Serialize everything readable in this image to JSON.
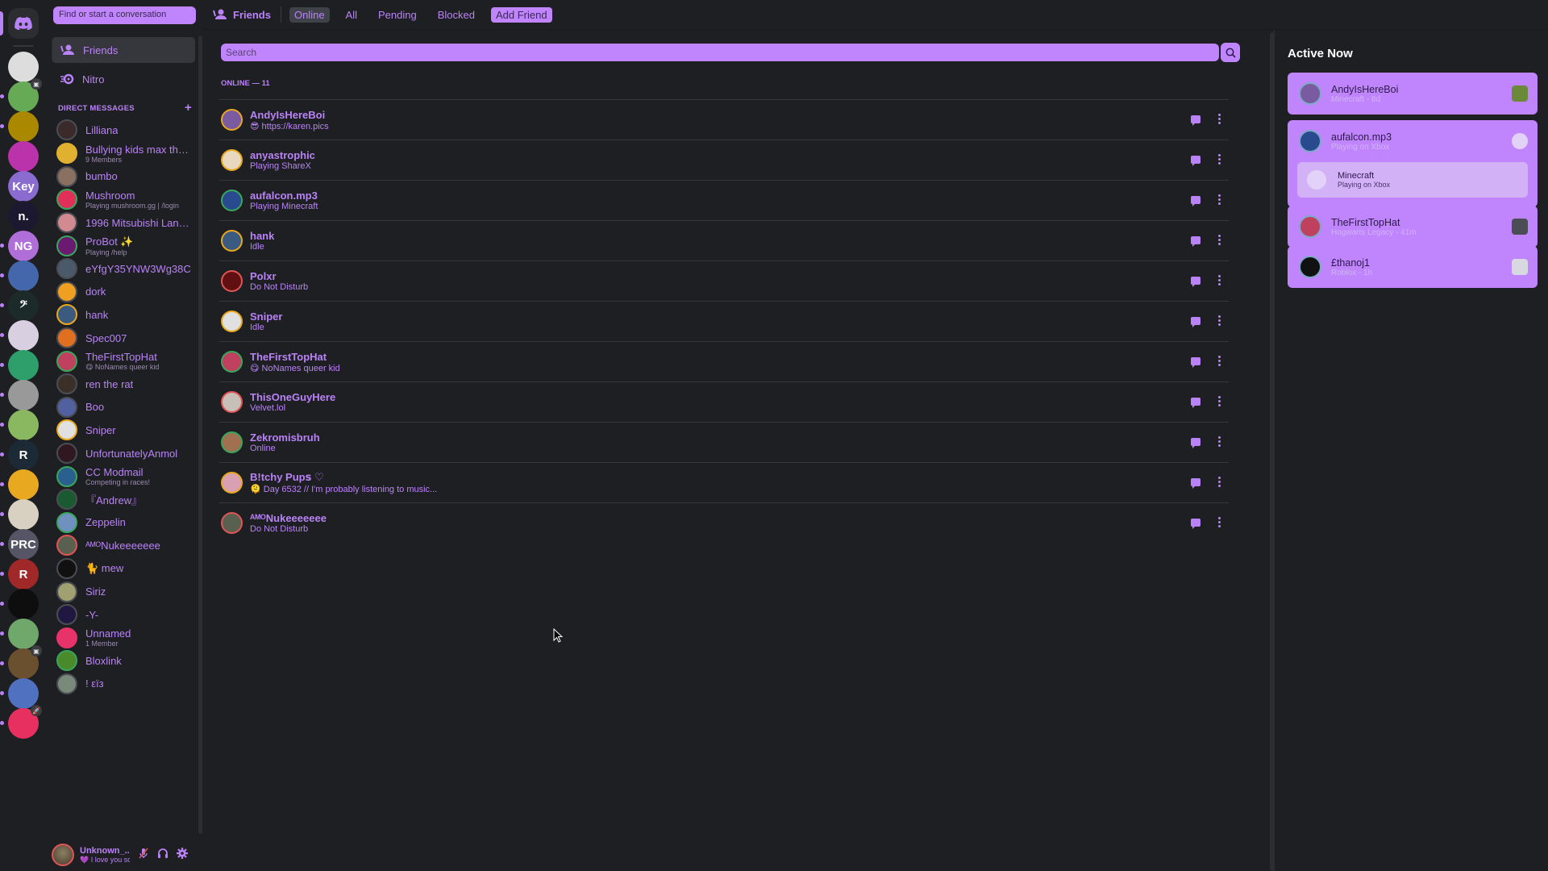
{
  "colors": {
    "accent": "#b983f7",
    "accent_fill": "#c085fc",
    "background": "#1e1f22",
    "idle": "#e8a820",
    "dnd": "#e05555",
    "online": "#3ba55c",
    "offline": "#4a4d54"
  },
  "servers": [
    {
      "name": "home",
      "icon": "discord-logo-icon"
    },
    {
      "name": "server-1",
      "color": "#ddd",
      "unread": false
    },
    {
      "name": "server-2",
      "color": "#6a5",
      "unread": true,
      "badge": "calendar-icon"
    },
    {
      "name": "server-3",
      "color": "#a80",
      "unread": true
    },
    {
      "name": "server-4",
      "color": "#b3a",
      "unread": false
    },
    {
      "name": "server-5",
      "label": "Key",
      "color": "#8a6bd0",
      "unread": false
    },
    {
      "name": "server-6",
      "label": "n.",
      "color": "#1c1830",
      "unread": false
    },
    {
      "name": "server-7",
      "label": "NG",
      "color": "#b06ed8",
      "unread": true
    },
    {
      "name": "server-8",
      "color": "#4466aa",
      "unread": true
    },
    {
      "name": "server-9",
      "label": "𝄢",
      "color": "#1c2a2a",
      "unread": true
    },
    {
      "name": "server-10",
      "color": "#d8d0e0",
      "unread": true
    },
    {
      "name": "server-11",
      "color": "#2e9e6a",
      "unread": true
    },
    {
      "name": "server-12",
      "color": "#999",
      "unread": true
    },
    {
      "name": "server-13",
      "color": "#8ab860",
      "unread": true
    },
    {
      "name": "server-14",
      "label": "R",
      "color": "#1c2a35",
      "unread": true
    },
    {
      "name": "server-15",
      "color": "#e8a820",
      "unread": true
    },
    {
      "name": "server-16",
      "color": "#d8d0c0",
      "unread": true
    },
    {
      "name": "server-17",
      "label": "PRC",
      "color": "#556",
      "unread": true
    },
    {
      "name": "server-18",
      "label": "R",
      "color": "#a02828",
      "unread": true
    },
    {
      "name": "server-19",
      "color": "#0e0e0e",
      "unread": true
    },
    {
      "name": "server-20",
      "color": "#6fa86a",
      "unread": true
    },
    {
      "name": "server-21",
      "color": "#6b5030",
      "unread": true,
      "badge": "calendar-icon"
    },
    {
      "name": "server-22",
      "color": "#5070c0",
      "unread": true
    },
    {
      "name": "server-23",
      "color": "#e83060",
      "unread": true,
      "badge": "rocket-icon"
    }
  ],
  "dm_sidebar": {
    "search_placeholder": "Find or start a conversation",
    "nav": [
      {
        "label": "Friends",
        "icon": "friends-icon"
      },
      {
        "label": "Nitro",
        "icon": "nitro-icon"
      }
    ],
    "header": "DIRECT MESSAGES",
    "add_label": "+",
    "items": [
      {
        "name": "Lilliana",
        "sub": "",
        "status": "offline",
        "color": "#3a2a2a"
      },
      {
        "name": "Bullying kids max the ...",
        "sub": "9 Members",
        "status": "group",
        "color": "#e0b030"
      },
      {
        "name": "bumbo",
        "sub": "",
        "status": "offline",
        "color": "#8a7060"
      },
      {
        "name": "Mushroom",
        "sub": "Playing mushroom.gg | /login",
        "status": "online",
        "color": "#e0305a"
      },
      {
        "name": "1996 Mitsubishi Lance...",
        "sub": "",
        "status": "offline",
        "color": "#d08a90"
      },
      {
        "name": "ProBot ✨",
        "sub": "Playing /help",
        "status": "online",
        "color": "#6a1a70"
      },
      {
        "name": "eYfgY35YNW3Wg38C",
        "sub": "",
        "status": "offline",
        "color": "#4a5a6a"
      },
      {
        "name": "dork",
        "sub": "",
        "status": "offline",
        "color": "#f0a020"
      },
      {
        "name": "hank",
        "sub": "",
        "status": "idle",
        "color": "#3a5a80"
      },
      {
        "name": "Spec007",
        "sub": "",
        "status": "offline",
        "color": "#e07020"
      },
      {
        "name": "TheFirstTopHat",
        "sub": "😋 NoNames queer kid",
        "status": "online",
        "color": "#c04060"
      },
      {
        "name": "ren the rat",
        "sub": "",
        "status": "offline",
        "color": "#3a3028"
      },
      {
        "name": "Boo",
        "sub": "",
        "status": "offline",
        "color": "#5060a0"
      },
      {
        "name": "Sniper",
        "sub": "",
        "status": "idle",
        "color": "#e0e0e0"
      },
      {
        "name": "UnfortunatelyAnmol",
        "sub": "",
        "status": "offline",
        "color": "#301820"
      },
      {
        "name": "CC Modmail",
        "sub": "Competing in races!",
        "status": "online",
        "color": "#2a6090"
      },
      {
        "name": "『Andrew』",
        "sub": "",
        "status": "offline",
        "color": "#1a5a30"
      },
      {
        "name": "Zeppelin",
        "sub": "",
        "status": "online",
        "color": "#7090c0"
      },
      {
        "name": "ᴬᴹᴼNukeeeeeee",
        "sub": "",
        "status": "dnd",
        "color": "#5a6050"
      },
      {
        "name": "🐈 mew",
        "sub": "",
        "status": "offline",
        "color": "#111"
      },
      {
        "name": "Siriz",
        "sub": "",
        "status": "offline",
        "color": "#a0a070"
      },
      {
        "name": "-Y-",
        "sub": "",
        "status": "offline",
        "color": "#201840"
      },
      {
        "name": "Unnamed",
        "sub": "1 Member",
        "status": "group",
        "color": "#e8336a"
      },
      {
        "name": "Bloxlink",
        "sub": "",
        "status": "online",
        "color": "#4a8a2a"
      },
      {
        "name": "! εïз",
        "sub": "",
        "status": "offline",
        "color": "#7a8a7a"
      }
    ]
  },
  "user_panel": {
    "name": "Unknown_...",
    "status": "💜 I love you sc",
    "icons": [
      "mute-mic-icon",
      "headphones-icon",
      "settings-gear-icon"
    ]
  },
  "topbar": {
    "title": "Friends",
    "tabs": [
      {
        "label": "Online",
        "selected": true
      },
      {
        "label": "All"
      },
      {
        "label": "Pending"
      },
      {
        "label": "Blocked"
      },
      {
        "label": "Add Friend",
        "style": "add"
      }
    ],
    "right_icons": [
      "new-group-dm-icon",
      "inbox-icon",
      "help-icon"
    ]
  },
  "search": {
    "placeholder": "Search"
  },
  "online_header": "ONLINE — 11",
  "friends": [
    {
      "name": "AndyIsHereBoi",
      "status_text": "😎 https://karen.pics",
      "status": "idle",
      "color": "#7a5aa0"
    },
    {
      "name": "anyastrophic",
      "status_text": "Playing ShareX",
      "status": "idle",
      "color": "#e8d8c0"
    },
    {
      "name": "aufalcon.mp3",
      "status_text": "Playing Minecraft",
      "status": "online",
      "color": "#2a4a90",
      "mobile": true
    },
    {
      "name": "hank",
      "status_text": "Idle",
      "status": "idle",
      "color": "#3a5a80"
    },
    {
      "name": "Polxr",
      "status_text": "Do Not Disturb",
      "status": "dnd",
      "color": "#601010"
    },
    {
      "name": "Sniper",
      "status_text": "Idle",
      "status": "idle",
      "color": "#e0e0e0"
    },
    {
      "name": "TheFirstTopHat",
      "status_text": "😋 NoNames queer kid",
      "status": "online",
      "color": "#c04060"
    },
    {
      "name": "ThisOneGuyHere",
      "status_text": "Velvet.lol",
      "status": "dnd",
      "color": "#c8c0b8"
    },
    {
      "name": "Zekromisbruh",
      "status_text": "Online",
      "status": "online",
      "color": "#a07050"
    },
    {
      "name": "B!tchy Pupꜱ ♡",
      "status_text": "🫠 Day 6532 // I'm probably listening to music...",
      "status": "idle",
      "color": "#d8a0b0"
    },
    {
      "name": "ᴬᴹᴼNukeeeeeee",
      "status_text": "Do Not Disturb",
      "status": "dnd",
      "color": "#5a6050"
    }
  ],
  "friend_actions": {
    "message": "message-icon",
    "more": "more-options-icon"
  },
  "active_now": {
    "title": "Active Now",
    "cards": [
      {
        "name": "AndyIsHereBoi",
        "sub": "Minecraft - 8d",
        "icon": "minecraft-icon",
        "color": "#7a5aa0"
      },
      {
        "name": "aufalcon.mp3",
        "sub": "Playing on Xbox",
        "icon": "xbox-icon",
        "color": "#2a4a90",
        "inner": {
          "name": "Minecraft",
          "sub": "Playing on Xbox"
        }
      },
      {
        "name": "TheFirstTopHat",
        "sub": "Hogwarts Legacy - 41m",
        "icon": "game-controller-icon",
        "color": "#c04060"
      },
      {
        "name": "£thanoj1",
        "sub": "Roblox - 1h",
        "icon": "roblox-icon",
        "color": "#111"
      }
    ]
  }
}
